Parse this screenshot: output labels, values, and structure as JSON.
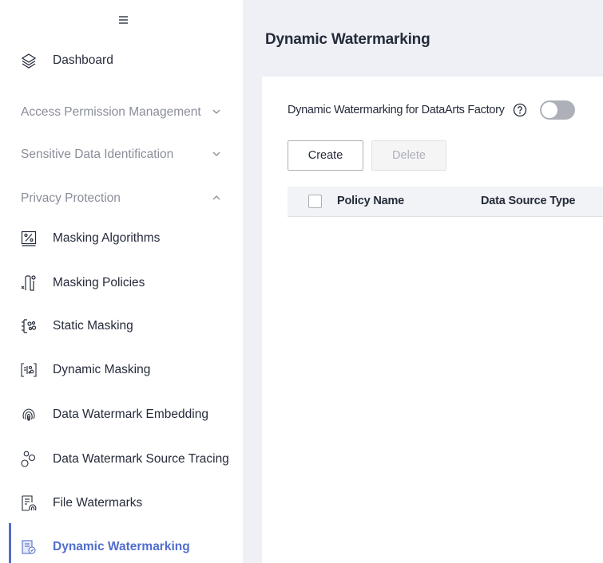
{
  "sidebar": {
    "dashboard": "Dashboard",
    "groups": {
      "access": "Access Permission Management",
      "sensitive": "Sensitive Data Identification",
      "privacy": "Privacy Protection"
    },
    "items": {
      "masking_algorithms": "Masking Algorithms",
      "masking_policies": "Masking Policies",
      "static_masking": "Static Masking",
      "dynamic_masking": "Dynamic Masking",
      "watermark_embedding": "Data Watermark Embedding",
      "watermark_tracing": "Data Watermark Source Tracing",
      "file_watermarks": "File Watermarks",
      "dynamic_watermarking": "Dynamic Watermarking"
    }
  },
  "main": {
    "title": "Dynamic Watermarking",
    "toggle_label": "Dynamic Watermarking for DataArts Factory",
    "toggle_state": "off",
    "buttons": {
      "create": "Create",
      "delete": "Delete"
    },
    "table": {
      "columns": [
        "Policy Name",
        "Data Source Type"
      ]
    }
  },
  "colors": {
    "accent": "#526ecc",
    "muted": "#8a8e99",
    "background": "#eef0f5"
  }
}
